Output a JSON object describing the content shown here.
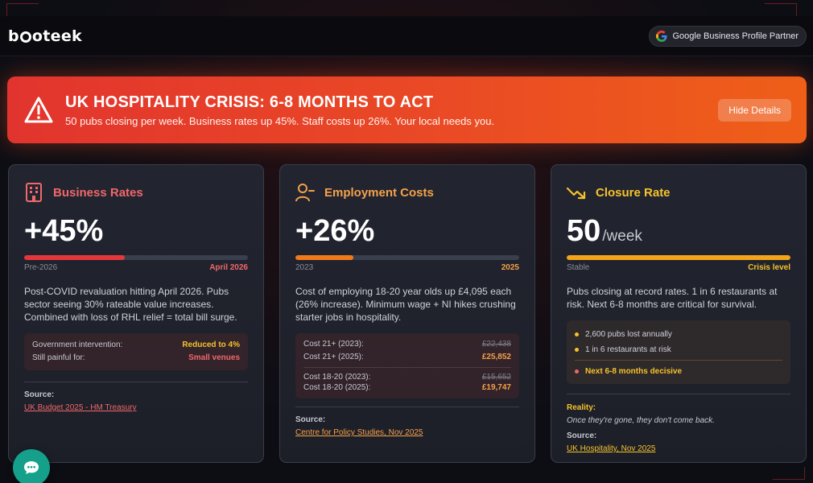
{
  "header": {
    "logo": "booteek",
    "partner_label": "Google Business Profile Partner"
  },
  "banner": {
    "title": "UK HOSPITALITY CRISIS: 6-8 MONTHS TO ACT",
    "subtitle": "50 pubs closing per week. Business rates up 45%. Staff costs up 26%. Your local needs you.",
    "button": "Hide Details"
  },
  "cards": {
    "rates": {
      "title": "Business Rates",
      "value": "+45%",
      "progress": 0.45,
      "bar_left": "Pre-2026",
      "bar_right": "April 2026",
      "description": "Post-COVID revaluation hitting April 2026. Pubs sector seeing 30% rateable value increases. Combined with loss of RHL relief = total bill surge.",
      "rows": [
        {
          "label": "Government intervention:",
          "value": "Reduced to 4%"
        },
        {
          "label": "Still painful for:",
          "value": "Small venues"
        }
      ],
      "source_label": "Source:",
      "source_link": "UK Budget 2025 - HM Treasury"
    },
    "employment": {
      "title": "Employment Costs",
      "value": "+26%",
      "progress": 0.26,
      "bar_left": "2023",
      "bar_right": "2025",
      "description": "Cost of employing 18-20 year olds up £4,095 each (26% increase). Minimum wage + NI hikes crushing starter jobs in hospitality.",
      "rows": [
        {
          "label": "Cost 21+ (2023):",
          "value": "£22,438"
        },
        {
          "label": "Cost 21+ (2025):",
          "value": "£25,852"
        },
        {
          "label": "Cost 18-20 (2023):",
          "value": "£15,652"
        },
        {
          "label": "Cost 18-20 (2025):",
          "value": "£19,747"
        }
      ],
      "source_label": "Source:",
      "source_link": "Centre for Policy Studies, Nov 2025"
    },
    "closure": {
      "title": "Closure Rate",
      "value": "50",
      "unit": "/week",
      "progress": 1.0,
      "bar_left": "Stable",
      "bar_right": "Crisis level",
      "description": "Pubs closing at record rates. 1 in 6 restaurants at risk. Next 6-8 months are critical for survival.",
      "bullets": [
        "2,600 pubs lost annually",
        "1 in 6 restaurants at risk",
        "Next 6-8 months decisive"
      ],
      "reality_label": "Reality:",
      "reality_text": "Once they're gone, they don't come back.",
      "source_label": "Source:",
      "source_link": "UK Hospitality, Nov 2025"
    }
  },
  "colors": {
    "rates": "#f0686a",
    "employment": "#f5a14a",
    "closure": "#f5c32c",
    "bar_rates": "#e4373b",
    "bar_employment": "#f07a1a",
    "bar_closure": "#f2a51a",
    "chat": "#14a08a"
  }
}
